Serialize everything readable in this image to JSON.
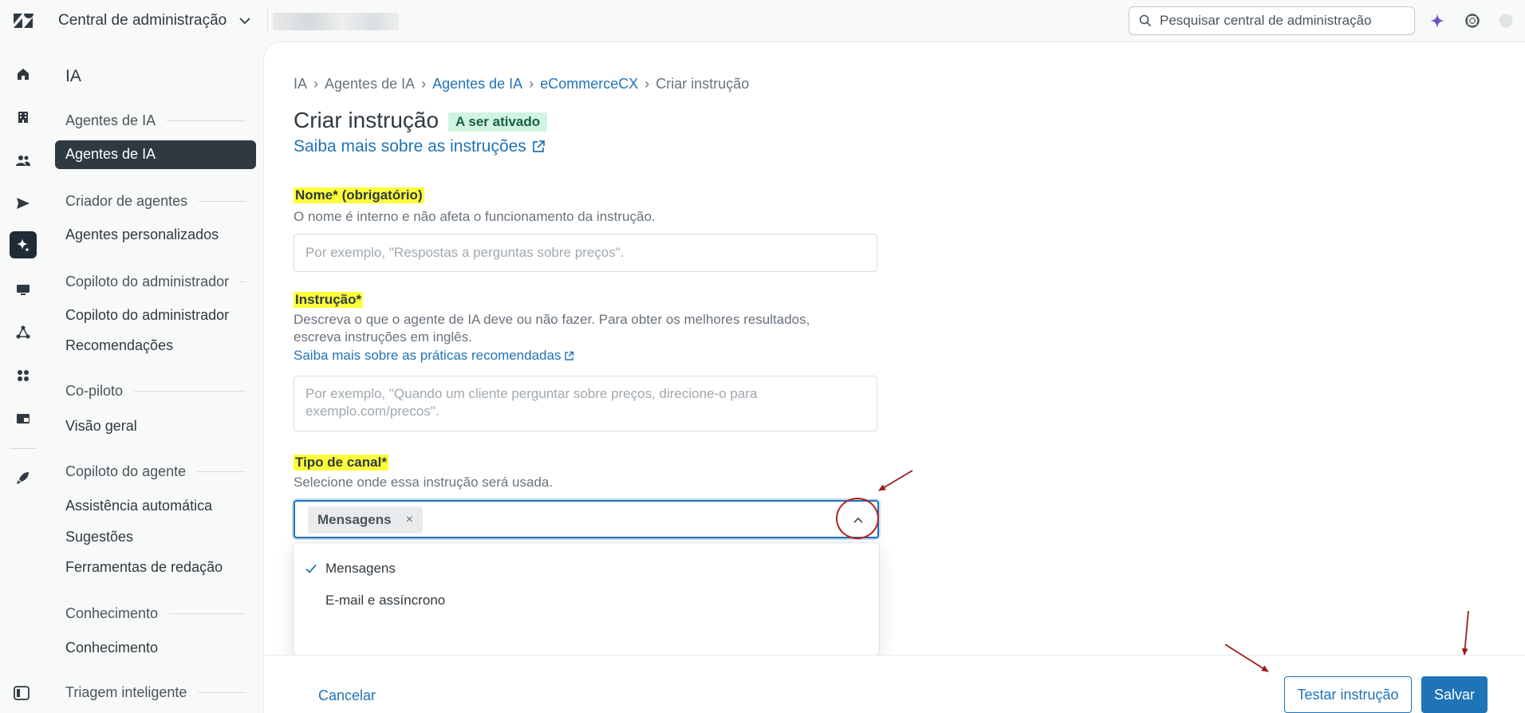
{
  "topbar": {
    "product_name": "Central de administração",
    "search_placeholder": "Pesquisar central de administração"
  },
  "sidebar": {
    "title": "IA",
    "sections": [
      {
        "heading": "Agentes de IA",
        "items": [
          "Agentes de IA"
        ]
      },
      {
        "heading": "Criador de agentes",
        "items": [
          "Agentes personalizados"
        ]
      },
      {
        "heading": "Copiloto do administrador",
        "items": [
          "Copiloto do administrador",
          "Recomendações"
        ]
      },
      {
        "heading": "Co-piloto",
        "items": [
          "Visão geral"
        ]
      },
      {
        "heading": "Copiloto do agente",
        "items": [
          "Assistência automática",
          "Sugestões",
          "Ferramentas de redação"
        ]
      },
      {
        "heading": "Conhecimento",
        "items": [
          "Conhecimento"
        ]
      },
      {
        "heading": "Triagem inteligente",
        "items": []
      }
    ],
    "active_item": "Agentes de IA"
  },
  "breadcrumb": [
    "IA",
    "Agentes de IA",
    "Agentes de IA",
    "eCommerceCX",
    "Criar instrução"
  ],
  "page": {
    "title": "Criar instrução",
    "badge": "A ser ativado",
    "learn_more": "Saiba mais sobre as instruções"
  },
  "form": {
    "name": {
      "label": "Nome* (obrigatório)",
      "hint": "O nome é interno e não afeta o funcionamento da instrução.",
      "placeholder": "Por exemplo, \"Respostas a perguntas sobre preços\".",
      "value": ""
    },
    "instruction": {
      "label": "Instrução*",
      "hint_line1": "Descreva o que o agente de IA deve ou não fazer. Para obter os melhores resultados,",
      "hint_line2": "escreva instruções em inglês.",
      "link": "Saiba mais sobre as práticas recomendadas",
      "placeholder": "Por exemplo, \"Quando um cliente perguntar sobre preços, direcione-o para exemplo.com/precos\".",
      "value": ""
    },
    "channel": {
      "label": "Tipo de canal*",
      "hint": "Selecione onde essa instrução será usada.",
      "selected_tag": "Mensagens",
      "remove_glyph": "×",
      "options": [
        {
          "label": "Mensagens",
          "checked": true
        },
        {
          "label": "E-mail e assíncrono",
          "checked": false
        }
      ]
    }
  },
  "footer": {
    "cancel": "Cancelar",
    "test": "Testar instrução",
    "save": "Salvar"
  },
  "colors": {
    "accent": "#1f73b7",
    "highlight": "#fdff3a",
    "badge_bg": "#d1f4e0",
    "annotation": "#b3231f"
  }
}
